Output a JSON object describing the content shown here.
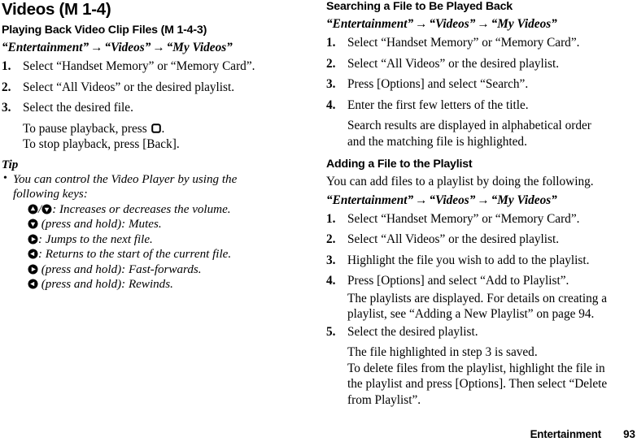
{
  "page": {
    "footer": {
      "chapter": "Entertainment",
      "page_number": "93"
    }
  },
  "left_column": {
    "title": "Videos (M 1-4)",
    "section": {
      "heading": "Playing Back Video Clip Files (M 1-4-3)",
      "nav_path": {
        "part1": "“Entertainment”",
        "arrow1": "→",
        "part2": "“Videos”",
        "arrow2": "→",
        "part3": "“My Videos”"
      },
      "steps": [
        {
          "num": "1.",
          "text": "Select “Handset Memory” or “Memory Card”."
        },
        {
          "num": "2.",
          "text": "Select “All Videos” or the desired playlist."
        },
        {
          "num": "3.",
          "text": "Select the desired file."
        }
      ],
      "notes": {
        "pause_prefix": "To pause playback, press ",
        "pause_icon": "center-key-icon",
        "pause_suffix": ".",
        "stop": "To stop playback, press [Back]."
      }
    },
    "tip": {
      "label": "Tip",
      "bullet": "•",
      "intro_line1": "You can control the Video Player by using the",
      "intro_line2": "following keys:",
      "keys": [
        {
          "icons": [
            "up-key-icon",
            "down-key-icon"
          ],
          "separator": "/",
          "text": ": Increases or decreases the volume."
        },
        {
          "icons": [
            "down-key-icon"
          ],
          "separator": "",
          "text": " (press and hold): Mutes."
        },
        {
          "icons": [
            "right-key-icon"
          ],
          "separator": "",
          "text": ": Jumps to the next file."
        },
        {
          "icons": [
            "left-key-icon"
          ],
          "separator": "",
          "text": ": Returns to the start of the current file."
        },
        {
          "icons": [
            "right-key-icon"
          ],
          "separator": "",
          "text": " (press and hold): Fast-forwards."
        },
        {
          "icons": [
            "left-key-icon"
          ],
          "separator": "",
          "text": " (press and hold): Rewinds."
        }
      ]
    }
  },
  "right_column": {
    "section_search": {
      "heading": "Searching a File to Be Played Back",
      "nav_path": {
        "part1": "“Entertainment”",
        "arrow1": "→",
        "part2": "“Videos”",
        "arrow2": "→",
        "part3": "“My Videos”"
      },
      "steps": [
        {
          "num": "1.",
          "text": "Select “Handset Memory” or “Memory Card”."
        },
        {
          "num": "2.",
          "text": "Select “All Videos” or the desired playlist."
        },
        {
          "num": "3.",
          "text": "Press [Options] and select “Search”."
        },
        {
          "num": "4.",
          "text": "Enter the first few letters of the title."
        }
      ],
      "note_line1": "Search results are displayed in alphabetical order",
      "note_line2": "and the matching file is highlighted."
    },
    "section_add": {
      "heading": "Adding a File to the Playlist",
      "intro": "You can add files to a playlist by doing the following.",
      "nav_path": {
        "part1": "“Entertainment”",
        "arrow1": "→",
        "part2": "“Videos”",
        "arrow2": "→",
        "part3": "“My Videos”"
      },
      "steps": [
        {
          "num": "1.",
          "text": "Select “Handset Memory” or “Memory Card”."
        },
        {
          "num": "2.",
          "text": "Select “All Videos” or the desired playlist."
        },
        {
          "num": "3.",
          "text": "Highlight the file you wish to add to the playlist."
        },
        {
          "num": "4.",
          "text": "Press [Options] and select “Add to Playlist”."
        }
      ],
      "note_after_4_line1": "The playlists are displayed. For details on creating a",
      "note_after_4_line2": "playlist, see “Adding a New Playlist” on page 94.",
      "step5": {
        "num": "5.",
        "text": "Select the desired playlist."
      },
      "note_after_5_line1": "The file highlighted in step 3 is saved.",
      "note_after_5_line2": "To delete files from the playlist, highlight the file in",
      "note_after_5_line3": "the playlist and press [Options]. Then select “Delete",
      "note_after_5_line4": "from Playlist”."
    }
  }
}
